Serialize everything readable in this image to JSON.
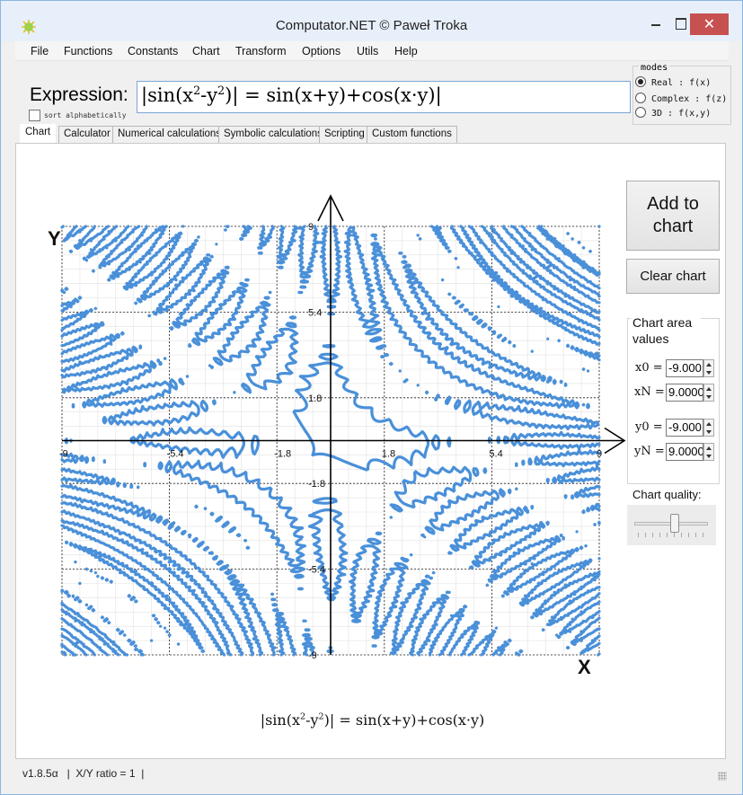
{
  "window": {
    "title": "Computator.NET © Paweł Troka",
    "close_glyph": "✕"
  },
  "menu": [
    "File",
    "Functions",
    "Constants",
    "Chart",
    "Transform",
    "Options",
    "Utils",
    "Help"
  ],
  "expression": {
    "label": "Expression:",
    "value": {
      "prefix": "|sin(x",
      "sq1": "2",
      "mid": "-y",
      "sq2": "2",
      "suffix": ")| = sin(x+y)+cos(x·y)|"
    },
    "sort_label": "sort alphabetically"
  },
  "modes": {
    "title": "modes",
    "options": [
      {
        "label": "Real : f(x)",
        "selected": true
      },
      {
        "label": "Complex : f(z)",
        "selected": false
      },
      {
        "label": "3D : f(x,y)",
        "selected": false
      }
    ]
  },
  "tabs": [
    "Chart",
    "Calculator",
    "Numerical calculations",
    "Symbolic calculations",
    "Scripting",
    "Custom functions"
  ],
  "active_tab": "Chart",
  "right_panel": {
    "add_to_chart": [
      "Add to",
      "chart"
    ],
    "clear_chart": "Clear chart",
    "area_title": "Chart area values",
    "x0_label": "x0 =",
    "x0_value": "-9.000",
    "xN_label": "xN =",
    "xN_value": "9.0000",
    "y0_label": "y0 =",
    "y0_value": "-9.000",
    "yN_label": "yN =",
    "yN_value": "9.0000",
    "quality_label": "Chart quality:",
    "quality_level": 0.55
  },
  "chart_data": {
    "type": "scatter",
    "description_mode": "implicit curve |sin(x^2-y^2)| = sin(x+y)+cos(x*y)",
    "xlim": [
      -9,
      9
    ],
    "ylim": [
      -9,
      9
    ],
    "x_ticks": [
      "-9",
      "-5.4",
      "-1.8",
      "1.8",
      "5.4",
      "9"
    ],
    "y_ticks": [
      "9",
      "5.4",
      "1.8",
      "-1.8",
      "-5.4",
      "-9"
    ],
    "xlabel": "X",
    "ylabel": "Y",
    "grid": true,
    "series_color": "#4a90d9",
    "caption": {
      "prefix": "|sin(x",
      "sq1": "2",
      "mid": "-y",
      "sq2": "2",
      "suffix": ")| = sin(x+y)+cos(x·y)"
    }
  },
  "status": "v1.8.5α   |  X/Y ratio = 1  |"
}
